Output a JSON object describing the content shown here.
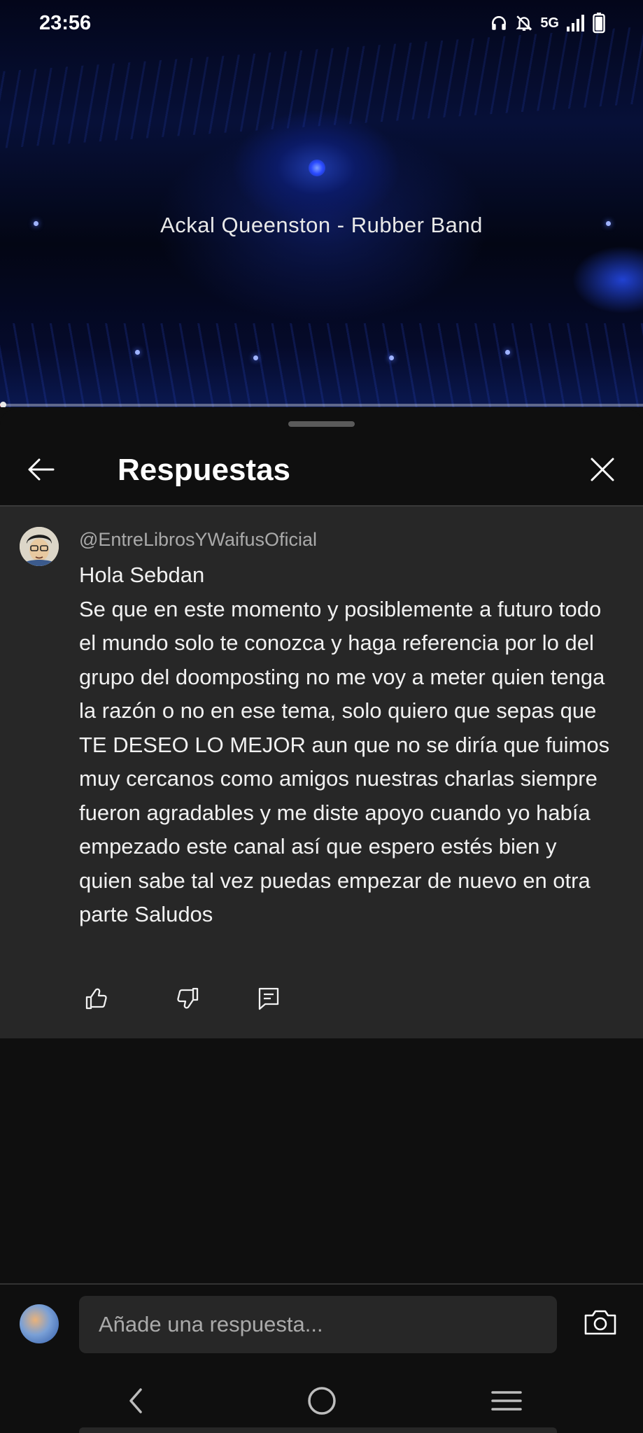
{
  "status_bar": {
    "time": "23:56",
    "network": "5G",
    "icons": [
      "headphones-icon",
      "notifications-muted-icon",
      "signal-icon",
      "battery-icon"
    ]
  },
  "video": {
    "title": "Ackal Queenston - Rubber Band",
    "progress": 0.003
  },
  "replies_panel": {
    "title": "Respuestas",
    "back_icon": "back-arrow-icon",
    "close_icon": "close-icon"
  },
  "comment": {
    "author": "@EntreLibrosYWaifusOficial",
    "text": "Hola Sebdan\nSe que en este momento y posiblemente a futuro todo el mundo solo te conozca y haga referencia por lo del grupo del doomposting no me voy a meter quien tenga la razón o no en ese tema, solo quiero que sepas que TE DESEO LO MEJOR aun que no se diría que fuimos muy cercanos como amigos nuestras charlas siempre fueron agradables y me diste apoyo cuando yo había empezado este canal así que espero estés bien y quien sabe tal vez puedas empezar de nuevo en otra parte Saludos",
    "actions": [
      "like-icon",
      "dislike-icon",
      "reply-icon"
    ]
  },
  "reply_bar": {
    "placeholder": "Añade una respuesta..."
  },
  "colors": {
    "background": "#0f0f0f",
    "comment_background": "#272727",
    "secondary_text": "#aaaaaa",
    "primary_text": "#f1f1f1"
  }
}
